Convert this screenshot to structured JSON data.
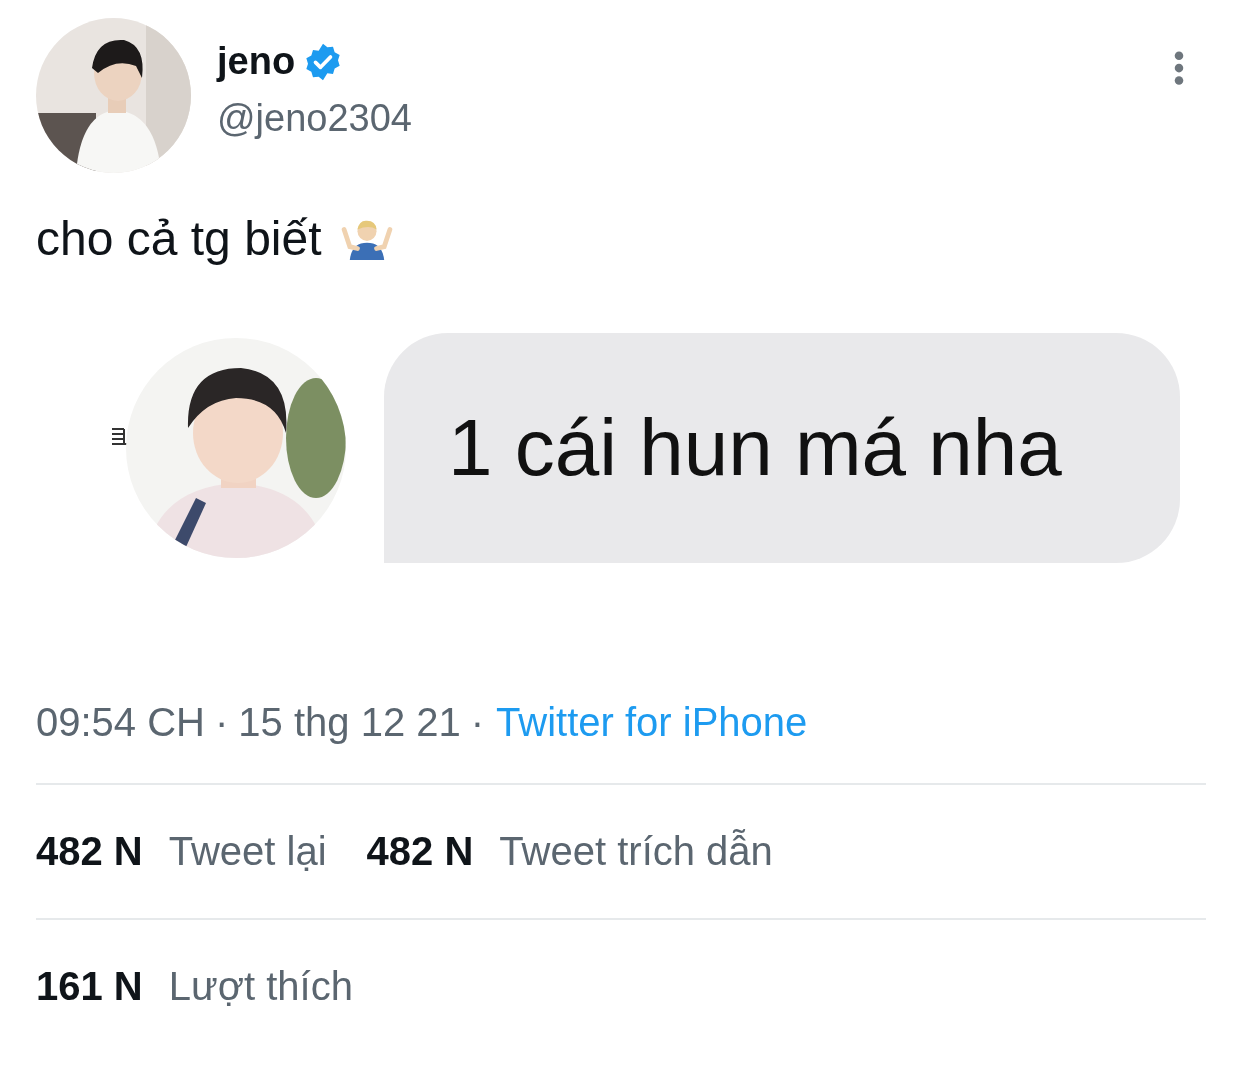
{
  "author": {
    "name": "jeno",
    "verified": true,
    "handle": "@jeno2304"
  },
  "tweet": {
    "text": "cho cả tg biết"
  },
  "media": {
    "message": "1 cái hun má nha"
  },
  "meta": {
    "time": "09:54 CH",
    "separator_1": "·",
    "date": "15 thg 12 21",
    "separator_2": "·",
    "source": "Twitter for iPhone"
  },
  "stats": [
    {
      "count": "482 N",
      "label": "Tweet lại"
    },
    {
      "count": "482 N",
      "label": "Tweet trích dẫn"
    }
  ],
  "likes": {
    "count": "161 N",
    "label": "Lượt thích"
  }
}
